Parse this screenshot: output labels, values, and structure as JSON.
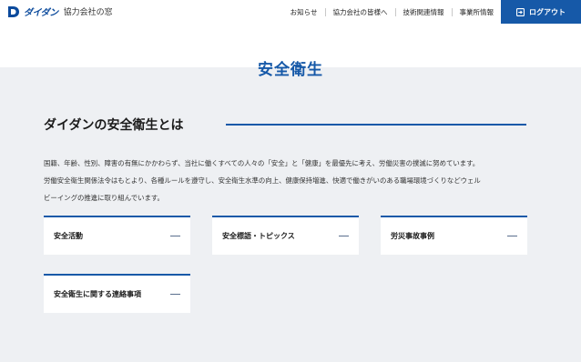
{
  "header": {
    "brand": "ダイダン",
    "subtitle": "協力会社の窓",
    "nav": [
      "お知らせ",
      "協力会社の皆様へ",
      "技術関連情報",
      "事業所情報"
    ],
    "logout_label": "ログアウト"
  },
  "page": {
    "title": "安全衛生"
  },
  "section": {
    "title": "ダイダンの安全衛生とは",
    "description": [
      "国籍、年齢、性別、障害の有無にかかわらず、当社に働くすべての人々の「安全」と「健康」を最優先に考え、労働災害の撲滅に努めています。",
      "労働安全衛生関係法令はもとより、各種ルールを遵守し、安全衛生水準の向上、健康保持増進、快適で働きがいのある職場環境づくりなどウェル",
      "ビーイングの推進に取り組んでいます。"
    ]
  },
  "cards": [
    "安全活動",
    "安全標語・トピックス",
    "労災事故事例",
    "安全衛生に関する連絡事項"
  ],
  "colors": {
    "accent": "#1659a8",
    "background": "#eef0f3"
  }
}
